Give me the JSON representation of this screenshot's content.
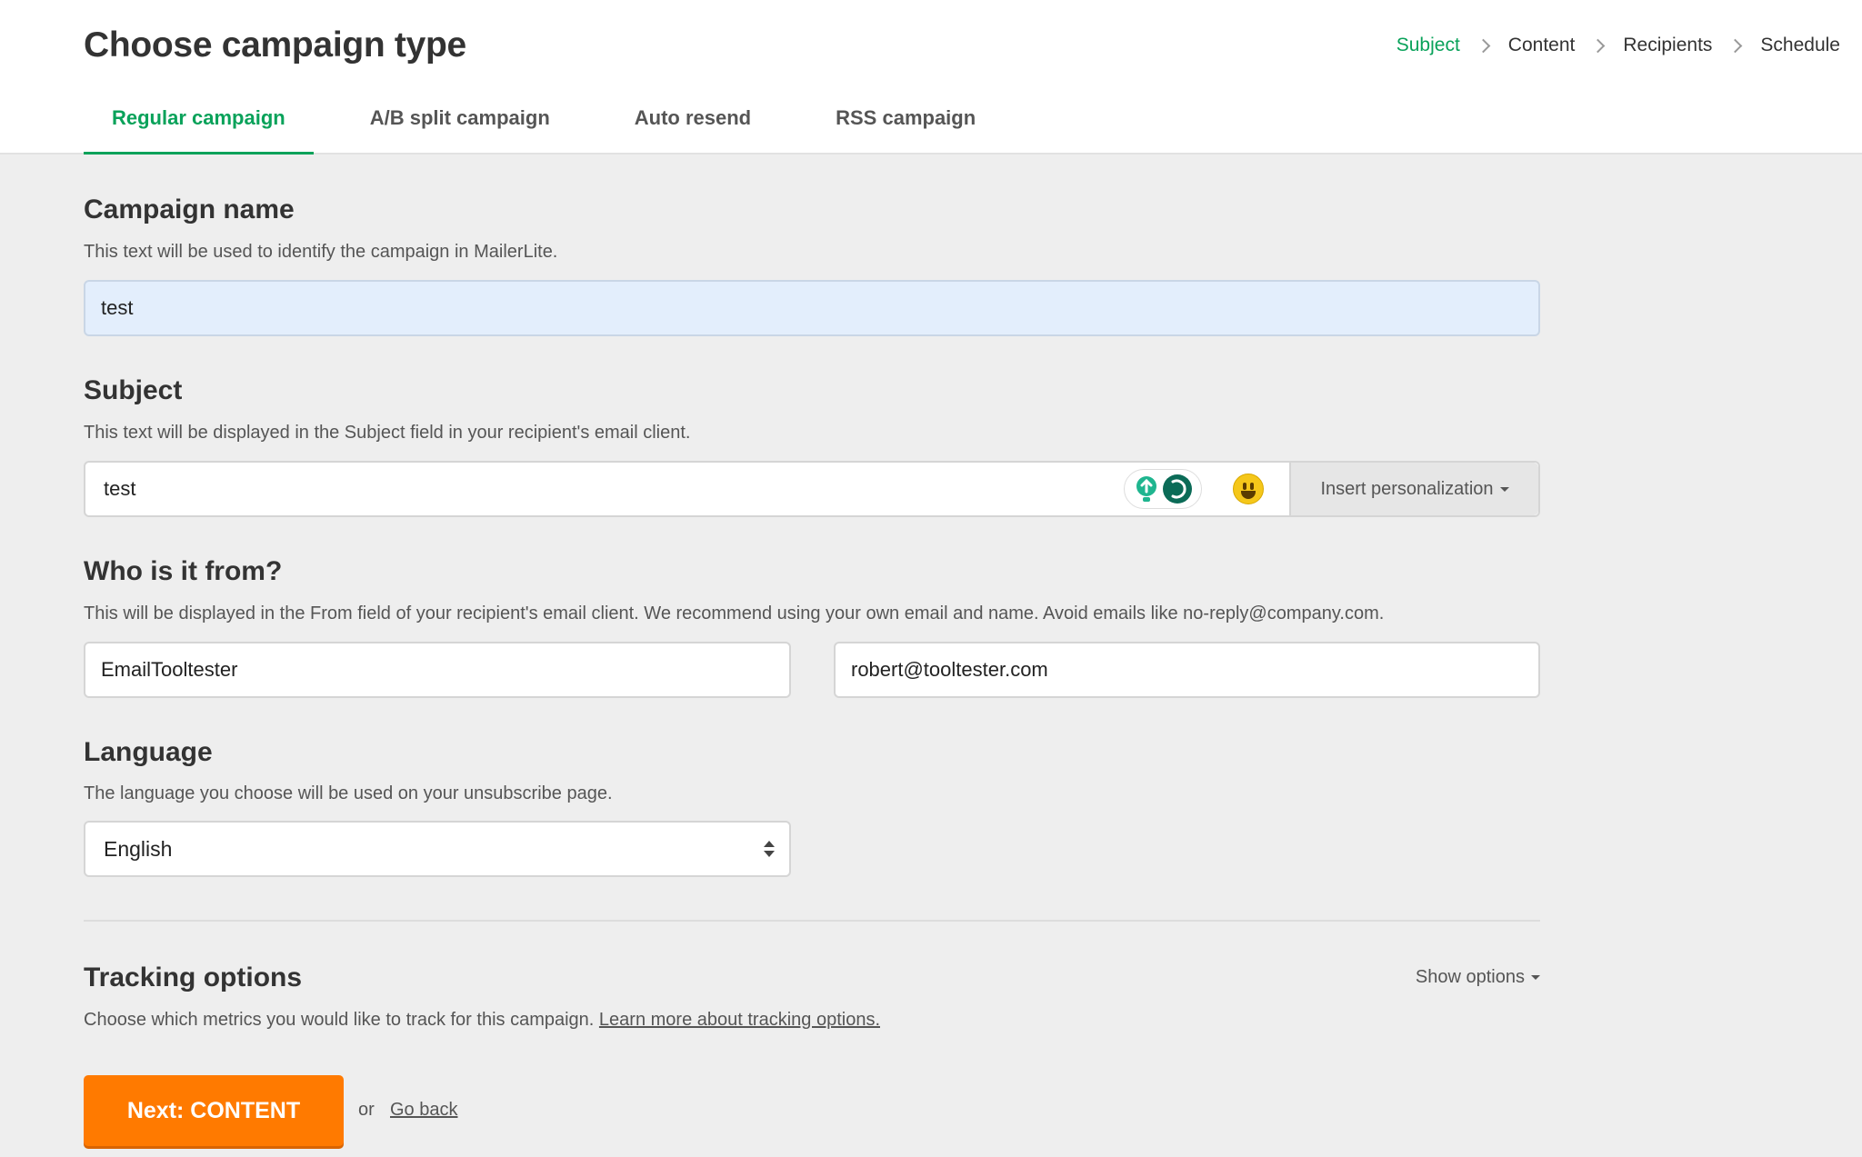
{
  "header": {
    "title": "Choose campaign type",
    "steps": [
      "Subject",
      "Content",
      "Recipients",
      "Schedule"
    ],
    "tabs": [
      "Regular campaign",
      "A/B split campaign",
      "Auto resend",
      "RSS campaign"
    ]
  },
  "campaign_name": {
    "title": "Campaign name",
    "description": "This text will be used to identify the campaign in MailerLite.",
    "value": "test"
  },
  "subject": {
    "title": "Subject",
    "description": "This text will be displayed in the Subject field in your recipient's email client.",
    "value": "test",
    "insert_label": "Insert personalization"
  },
  "from": {
    "title": "Who is it from?",
    "description": "This will be displayed in the From field of your recipient's email client. We recommend using your own email and name. Avoid emails like no-reply@company.com.",
    "name_value": "EmailTooltester",
    "email_value": "robert@tooltester.com"
  },
  "language": {
    "title": "Language",
    "description": "The language you choose will be used on your unsubscribe page.",
    "selected": "English"
  },
  "tracking": {
    "title": "Tracking options",
    "description": "Choose which metrics you would like to track for this campaign.",
    "learn_more": "Learn more about tracking options.",
    "show_options": "Show options"
  },
  "footer": {
    "next_label": "Next: CONTENT",
    "or": "or",
    "go_back": "Go back"
  },
  "colors": {
    "accent_green": "#09a25a",
    "primary_orange": "#ff7a00",
    "focused_input": "#e3eefc"
  }
}
